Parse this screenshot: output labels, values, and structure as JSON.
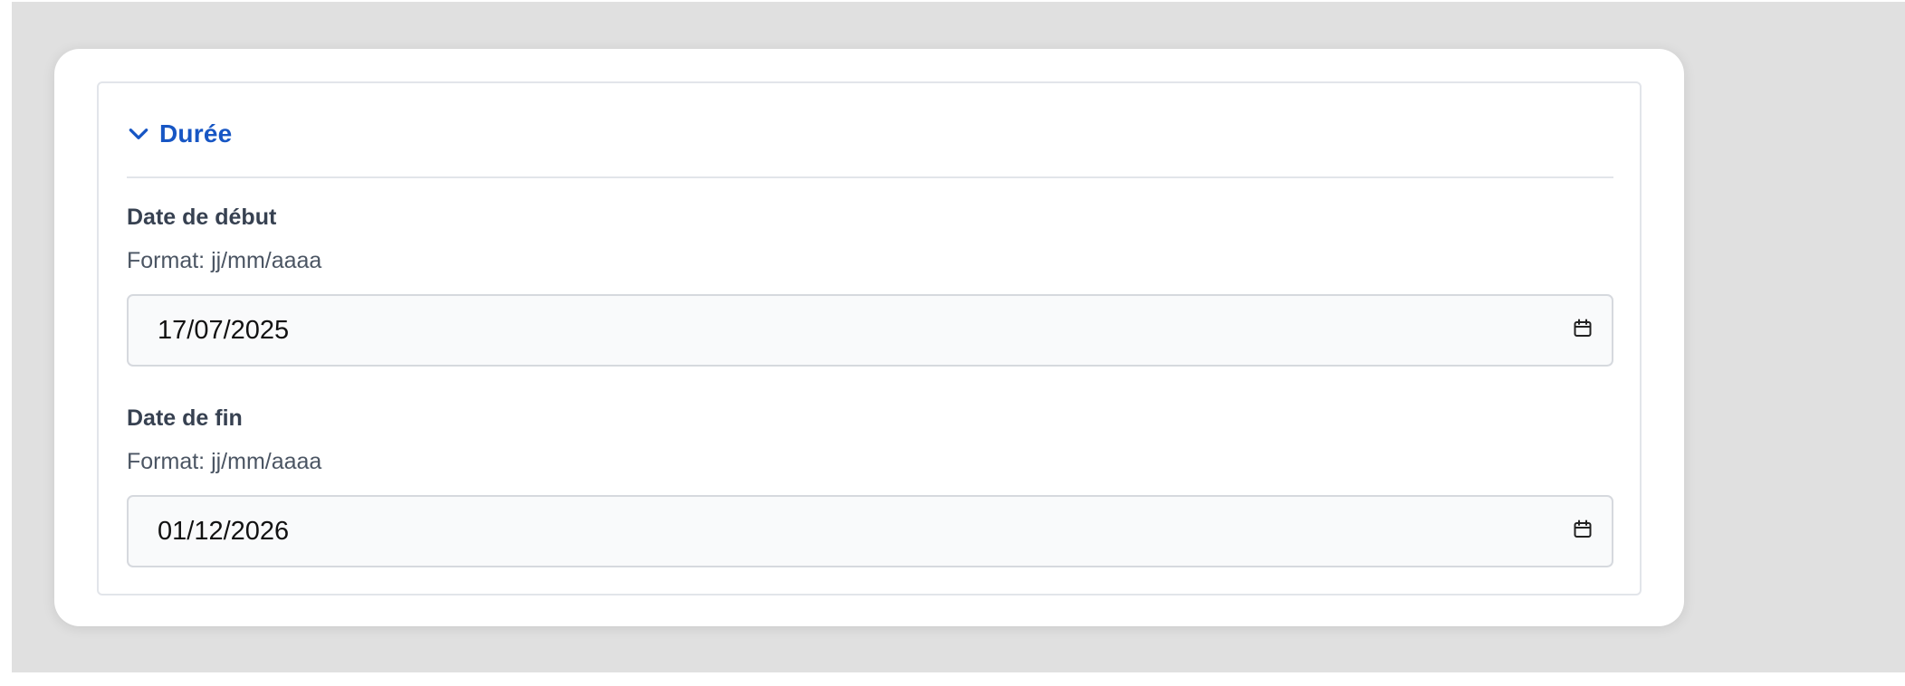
{
  "section": {
    "title": "Durée",
    "expanded": true,
    "accent_color": "#1756c4"
  },
  "start_date": {
    "label": "Date de début",
    "hint": "Format: jj/mm/aaaa",
    "value": "17/07/2025",
    "icon": "calendar-icon"
  },
  "end_date": {
    "label": "Date de fin",
    "hint": "Format: jj/mm/aaaa",
    "value": "01/12/2026",
    "icon": "calendar-icon"
  }
}
